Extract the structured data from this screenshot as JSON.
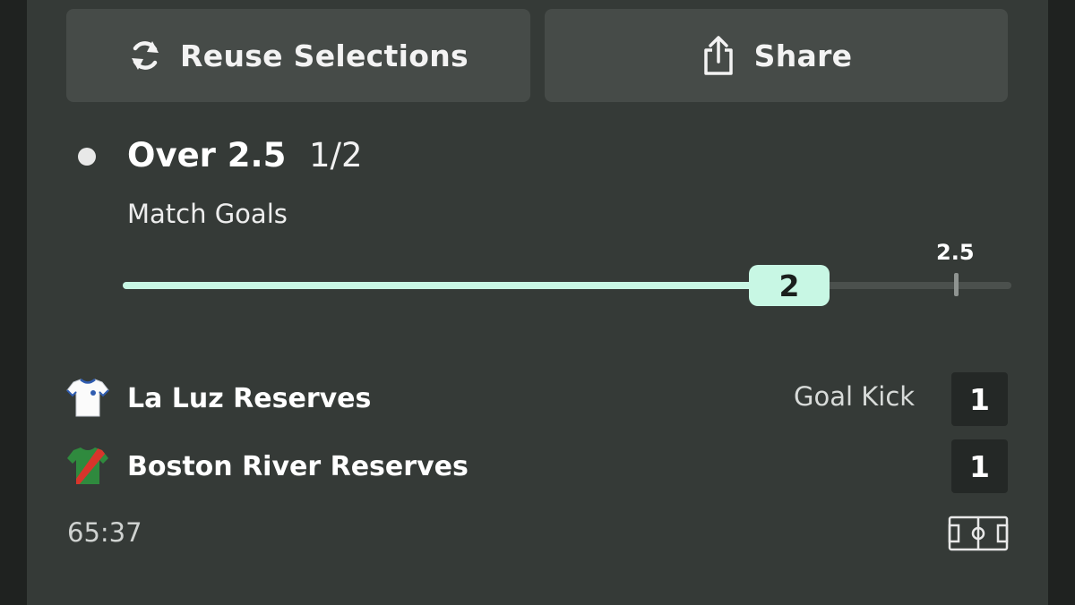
{
  "actions": {
    "reuse_label": "Reuse Selections",
    "share_label": "Share"
  },
  "selection": {
    "title": "Over 2.5",
    "odds": "1/2",
    "market": "Match Goals"
  },
  "goal_tracker": {
    "current_value": 2,
    "current_label": "2",
    "line_value": 2.5,
    "line_label": "2.5",
    "progress_fraction": 0.75,
    "fill_color": "#c8f7e4"
  },
  "match": {
    "home": {
      "name": "La Luz Reserves",
      "score": "1",
      "shirt": "white-shirt-icon"
    },
    "away": {
      "name": "Boston River Reserves",
      "score": "1",
      "shirt": "green-red-sash-shirt-icon"
    },
    "event": "Goal Kick",
    "clock": "65:37"
  }
}
